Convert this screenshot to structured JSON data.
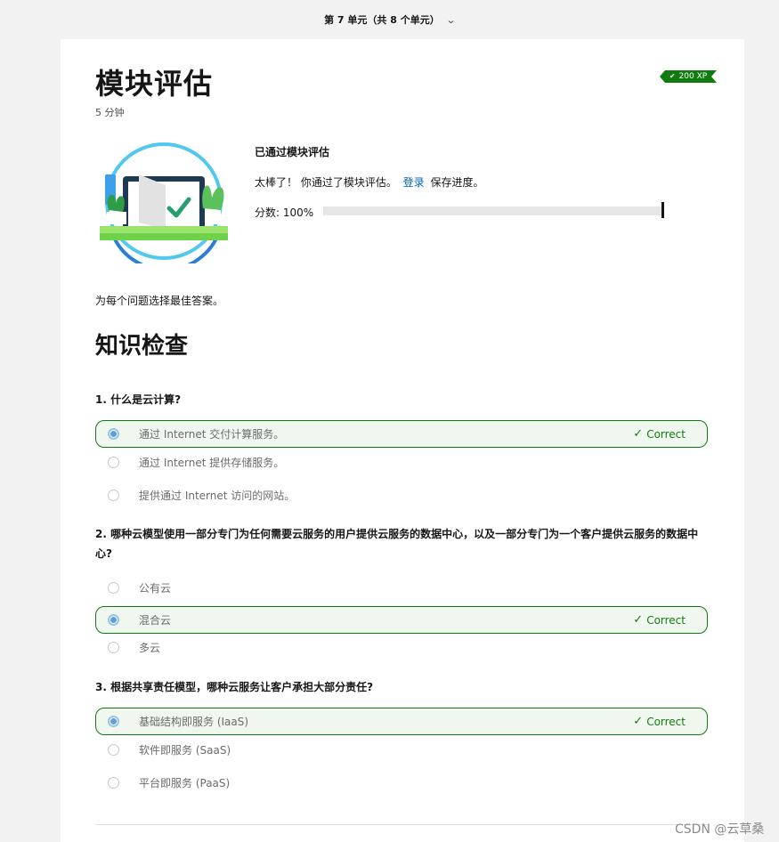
{
  "header": {
    "unit_label": "第 7 单元（共 8 个单元）"
  },
  "module": {
    "title": "模块评估",
    "duration": "5 分钟",
    "xp_badge": "200 XP"
  },
  "result": {
    "title": "已通过模块评估",
    "message_before": "太棒了！ 你通过了模块评估。",
    "login_link": "登录",
    "message_after": "保存进度。",
    "score_label": "分数: 100%",
    "score_percent": 100
  },
  "instruction": "为每个问题选择最佳答案。",
  "section_title": "知识检查",
  "correct_label": "Correct",
  "colors": {
    "correct_green": "#107c10",
    "correct_bg": "#f0f7ef",
    "link_blue": "#0065b3"
  },
  "questions": [
    {
      "text": "1. 什么是云计算?",
      "options": [
        {
          "text": "通过 Internet 交付计算服务。",
          "selected": true
        },
        {
          "text": "通过 Internet 提供存储服务。",
          "selected": false
        },
        {
          "text": "提供通过 Internet 访问的网站。",
          "selected": false
        }
      ]
    },
    {
      "text": "2. 哪种云模型使用一部分专门为任何需要云服务的用户提供云服务的数据中心，以及一部分专门为一个客户提供云服务的数据中心?",
      "options": [
        {
          "text": "公有云",
          "selected": false
        },
        {
          "text": "混合云",
          "selected": true
        },
        {
          "text": "多云",
          "selected": false
        }
      ]
    },
    {
      "text": "3. 根据共享责任模型，哪种云服务让客户承担大部分责任?",
      "options": [
        {
          "text": "基础结构即服务 (IaaS)",
          "selected": true
        },
        {
          "text": "软件即服务 (SaaS)",
          "selected": false
        },
        {
          "text": "平台即服务 (PaaS)",
          "selected": false
        }
      ]
    }
  ],
  "watermark": "CSDN @云草桑"
}
